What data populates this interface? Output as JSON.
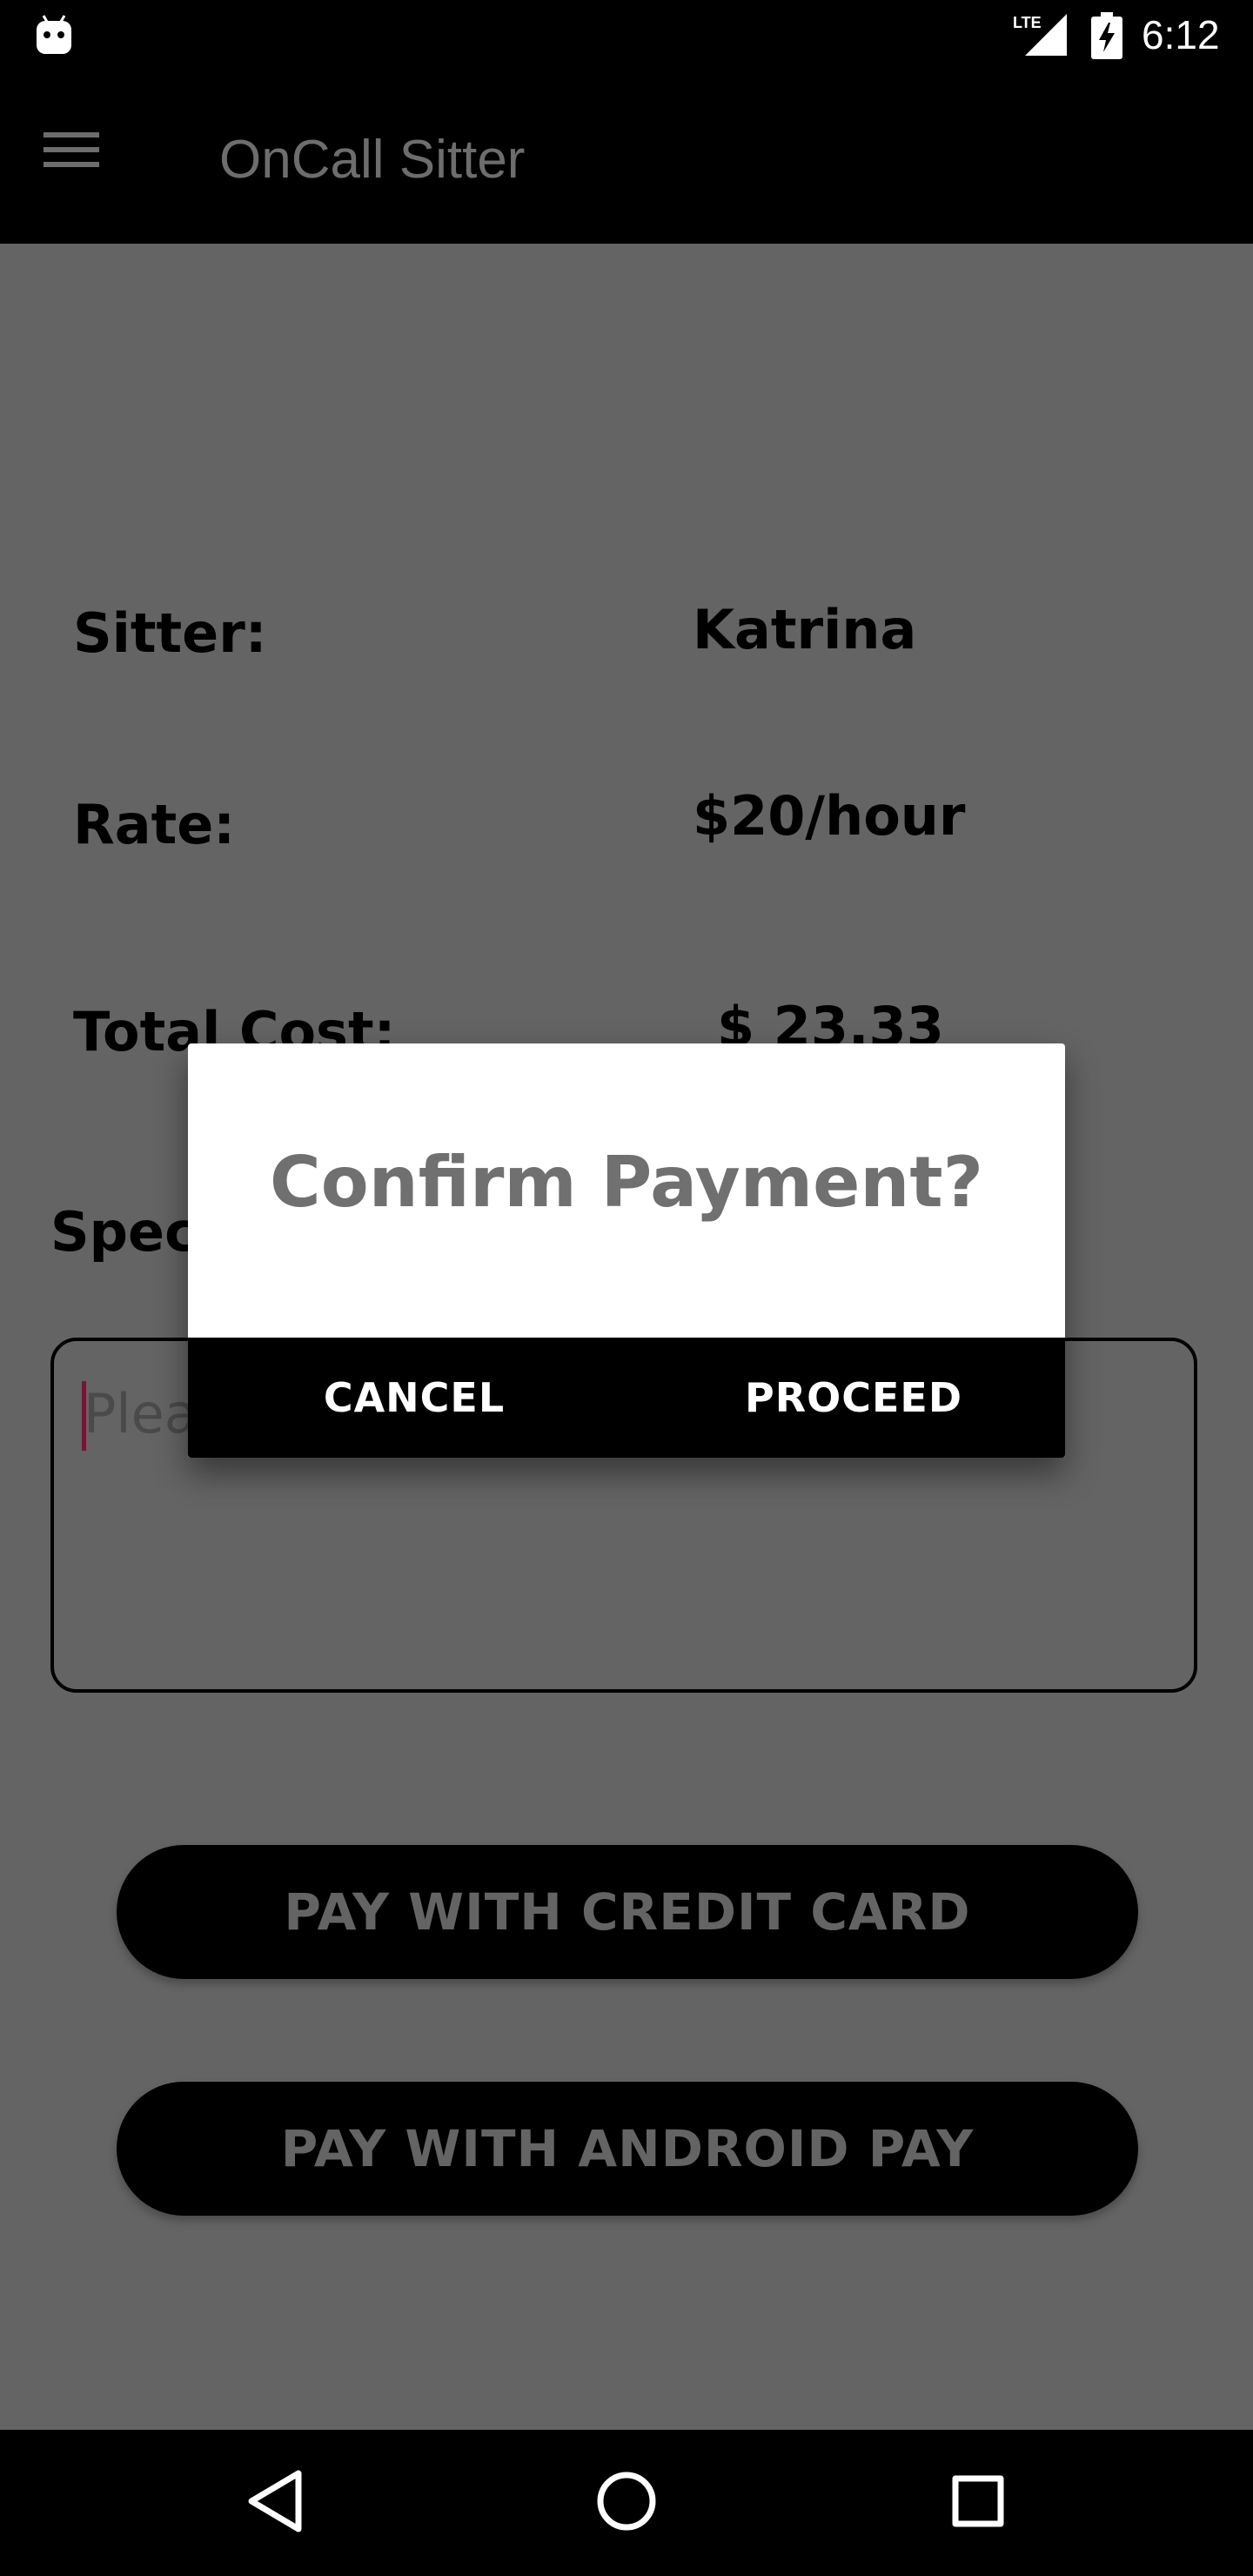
{
  "status_bar": {
    "time": "6:12",
    "network_label": "LTE",
    "icons": [
      "android-debug-icon",
      "lte-signal-icon",
      "battery-charging-icon"
    ]
  },
  "app_bar": {
    "title": "OnCall Sitter",
    "menu_icon": "hamburger-menu-icon"
  },
  "details": {
    "sitter_label": "Sitter:",
    "sitter_value": "Katrina",
    "rate_label": "Rate:",
    "rate_value": "$20/hour",
    "total_label": "Total Cost:",
    "total_value": "$ 23.33"
  },
  "special": {
    "label_visible": "Spec",
    "placeholder_visible": "Plea"
  },
  "buttons": {
    "credit_card": "PAY WITH CREDIT CARD",
    "android_pay": "PAY WITH ANDROID PAY"
  },
  "dialog": {
    "title": "Confirm Payment?",
    "cancel": "CANCEL",
    "proceed": "PROCEED"
  },
  "nav_bar": {
    "icons": [
      "back-icon",
      "home-icon",
      "recent-apps-icon"
    ]
  },
  "colors": {
    "background_dim": "#646464",
    "bars": "#000000",
    "dialog_surface": "#ffffff",
    "caret": "#7a1337"
  }
}
